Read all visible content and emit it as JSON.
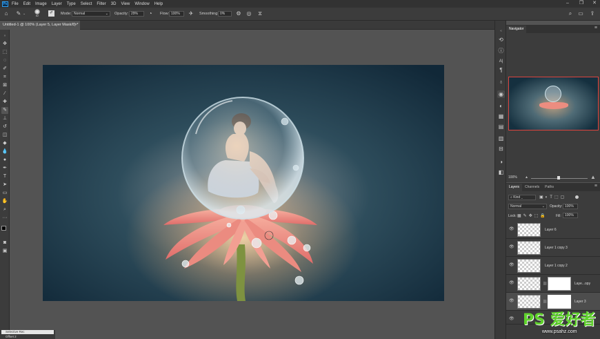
{
  "menu": {
    "items": [
      "File",
      "Edit",
      "Image",
      "Layer",
      "Type",
      "Select",
      "Filter",
      "3D",
      "View",
      "Window",
      "Help"
    ]
  },
  "options": {
    "brush_size": "82",
    "mode_label": "Mode:",
    "mode_value": "Normal",
    "opacity_label": "Opacity:",
    "opacity_value": "29%",
    "flow_label": "Flow:",
    "flow_value": "100%",
    "smoothing_label": "Smoothing:",
    "smoothing_value": "0%"
  },
  "document": {
    "tab_title": "Untitled-1 @ 100% (Layer 5, Layer Mask/8) *"
  },
  "navigator": {
    "tab": "Navigator",
    "zoom": "100%"
  },
  "layers_panel": {
    "tabs": [
      "Layers",
      "Channels",
      "Paths"
    ],
    "filter_kind": "Kind",
    "blend_mode": "Normal",
    "opacity_label": "Opacity:",
    "opacity_value": "100%",
    "lock_label": "Lock:",
    "fill_label": "Fill:",
    "fill_value": "100%",
    "layers": [
      {
        "name": "Layer 6",
        "has_mask": false,
        "selected": false
      },
      {
        "name": "Layer 1 copy 3",
        "has_mask": false,
        "selected": false
      },
      {
        "name": "Layer 1 copy 2",
        "has_mask": false,
        "selected": false
      },
      {
        "name": "Laye...opy",
        "has_mask": true,
        "selected": false
      },
      {
        "name": "Layer 3",
        "has_mask": true,
        "selected": true
      }
    ]
  },
  "bottom": {
    "item1": "Selective Rec",
    "item2": "Offset 2"
  },
  "watermark": {
    "text": "PS 爱好者",
    "url": "www.psahz.com"
  },
  "colors": {
    "accent": "#31a8ff",
    "navigator_frame": "#e0443e",
    "bg": "#535353",
    "panel": "#3c3c3c"
  }
}
